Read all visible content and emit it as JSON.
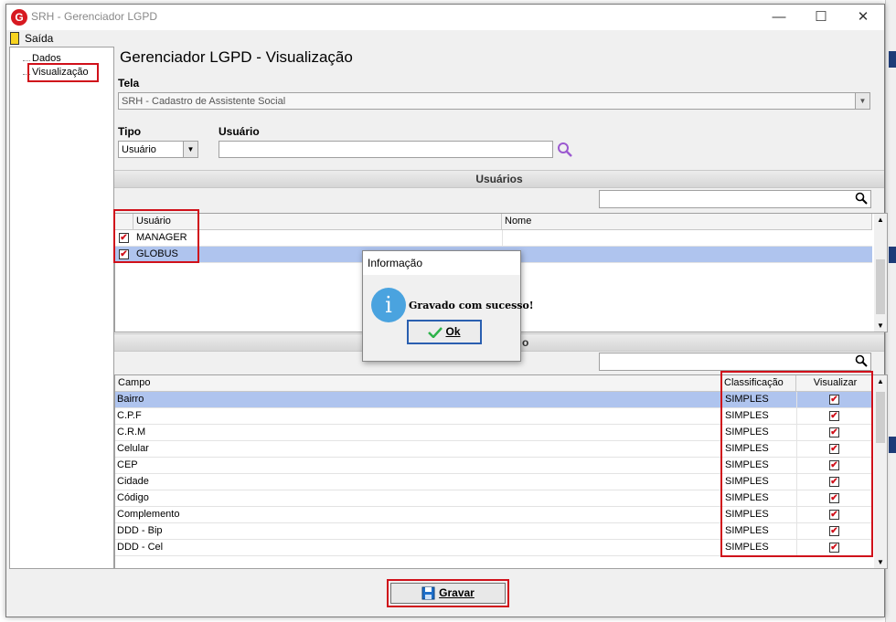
{
  "window": {
    "title": "SRH - Gerenciador LGPD",
    "minimize": "—",
    "maximize": "☐",
    "close": "✕",
    "logo_letter": "G"
  },
  "menu": {
    "exit_label": "Saída"
  },
  "tree": {
    "items": [
      "Dados",
      "Visualização"
    ]
  },
  "page": {
    "title": "Gerenciador LGPD - Visualização"
  },
  "tela": {
    "label": "Tela",
    "value": "SRH - Cadastro de Assistente Social"
  },
  "tipo": {
    "label": "Tipo",
    "value": "Usuário"
  },
  "usuario": {
    "label": "Usuário",
    "value": ""
  },
  "users_section": {
    "title": "Usuários",
    "columns": [
      "Usuário",
      "Nome"
    ],
    "rows": [
      {
        "usuario": "MANAGER",
        "nome": "",
        "checked": true
      },
      {
        "usuario": "GLOBUS",
        "nome": "",
        "checked": true
      }
    ]
  },
  "fields_section": {
    "title_partial": "o",
    "columns": [
      "Campo",
      "Classificação",
      "Visualizar"
    ],
    "rows": [
      {
        "campo": "Bairro",
        "classificacao": "SIMPLES",
        "visualizar": true
      },
      {
        "campo": "C.P.F",
        "classificacao": "SIMPLES",
        "visualizar": true
      },
      {
        "campo": "C.R.M",
        "classificacao": "SIMPLES",
        "visualizar": true
      },
      {
        "campo": "Celular",
        "classificacao": "SIMPLES",
        "visualizar": true
      },
      {
        "campo": "CEP",
        "classificacao": "SIMPLES",
        "visualizar": true
      },
      {
        "campo": "Cidade",
        "classificacao": "SIMPLES",
        "visualizar": true
      },
      {
        "campo": "Código",
        "classificacao": "SIMPLES",
        "visualizar": true
      },
      {
        "campo": "Complemento",
        "classificacao": "SIMPLES",
        "visualizar": true
      },
      {
        "campo": "DDD - Bip",
        "classificacao": "SIMPLES",
        "visualizar": true
      },
      {
        "campo": "DDD - Cel",
        "classificacao": "SIMPLES",
        "visualizar": true
      }
    ]
  },
  "dialog": {
    "title": "Informação",
    "message": "Gravado com sucesso!",
    "ok_label": "Ok",
    "icon_letter": "i"
  },
  "footer": {
    "save_label": "Gravar"
  },
  "colors": {
    "accent_red": "#d0101a",
    "selection": "#afc4ee",
    "info_icon": "#4aa3df"
  }
}
